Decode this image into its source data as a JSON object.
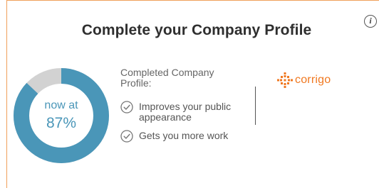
{
  "card": {
    "title": "Complete your Company Profile",
    "info_icon": "info-icon",
    "info_glyph": "i"
  },
  "progress": {
    "label": "now at",
    "value_text": "87%",
    "percent": 87,
    "fill_color": "#4a96b8",
    "track_color": "#d2d2d2"
  },
  "profile": {
    "heading": "Completed Company Profile:"
  },
  "benefits": [
    {
      "icon": "check-circle-icon",
      "text": "Improves your public appearance"
    },
    {
      "icon": "check-circle-icon",
      "text": "Gets you more work"
    }
  ],
  "brand": {
    "logo_icon": "corrigo-logo-icon",
    "name": "corrigo",
    "color": "#f07820"
  }
}
